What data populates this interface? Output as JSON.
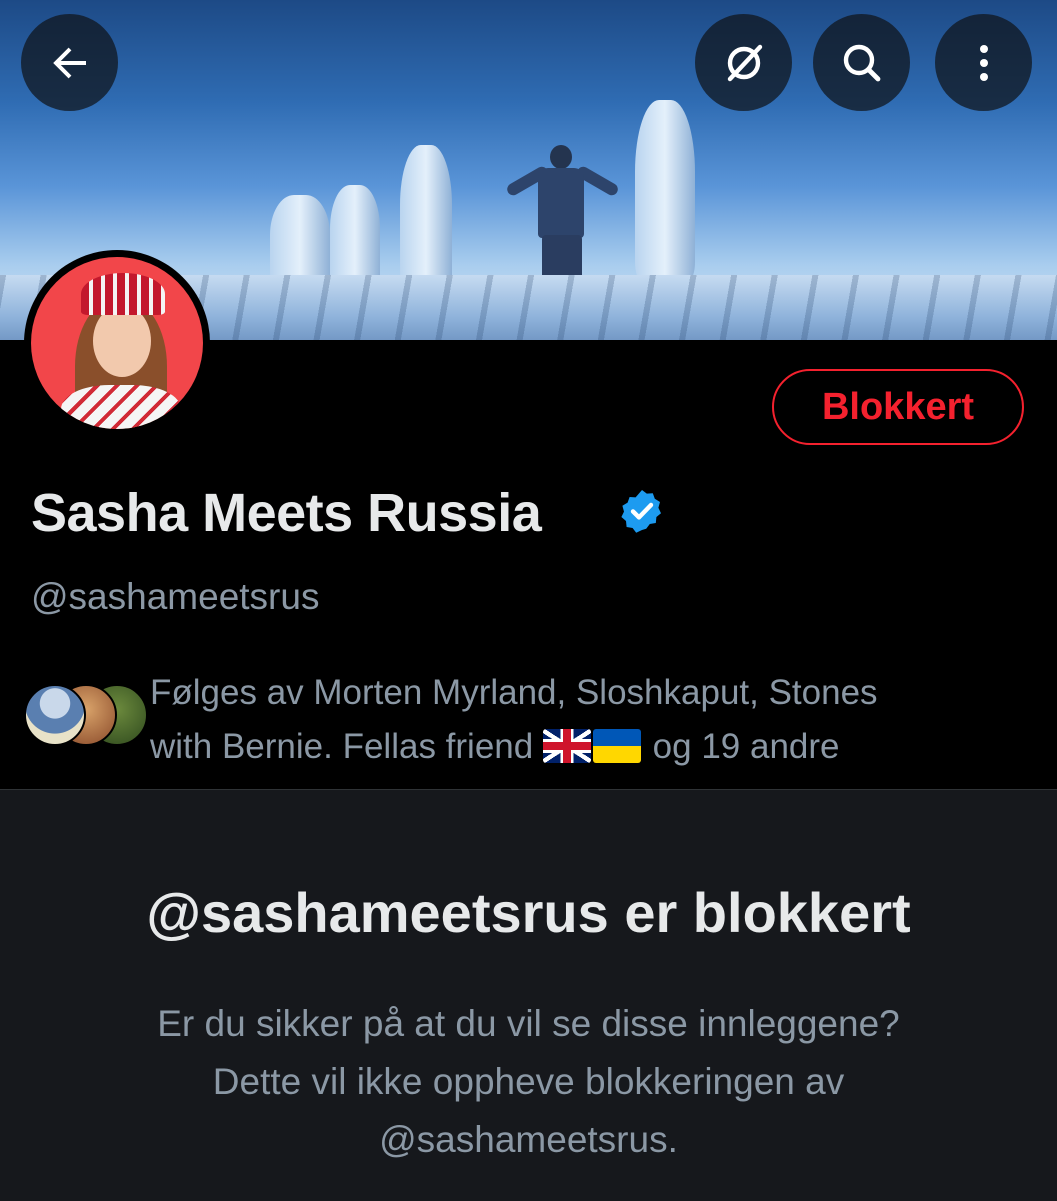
{
  "header": {
    "back_icon": "arrow-left-icon",
    "grok_icon": "slashed-circle-icon",
    "search_icon": "search-icon",
    "more_icon": "more-vertical-icon"
  },
  "profile": {
    "display_name": "Sasha Meets Russia",
    "verified": true,
    "handle": "@sashameetsrus",
    "block_button_label": "Blokkert",
    "followers_line1": "Følges av Morten Myrland, Sloshkaput, Stones",
    "followers_line2_a": "with Bernie. Fellas friend ",
    "followers_line2_b": " og 19 andre"
  },
  "blocked_notice": {
    "title": "@sashameetsrus er blokkert",
    "line1": "Er du sikker på at du vil se disse innleggene?",
    "line2": "Dette vil ikke oppheve blokkeringen av",
    "line3": "@sashameetsrus."
  },
  "colors": {
    "background": "#000000",
    "panel": "#16181c",
    "blocked_red": "#f4212e",
    "verified_blue": "#1d9bf0",
    "secondary_text": "#8b98a5"
  }
}
